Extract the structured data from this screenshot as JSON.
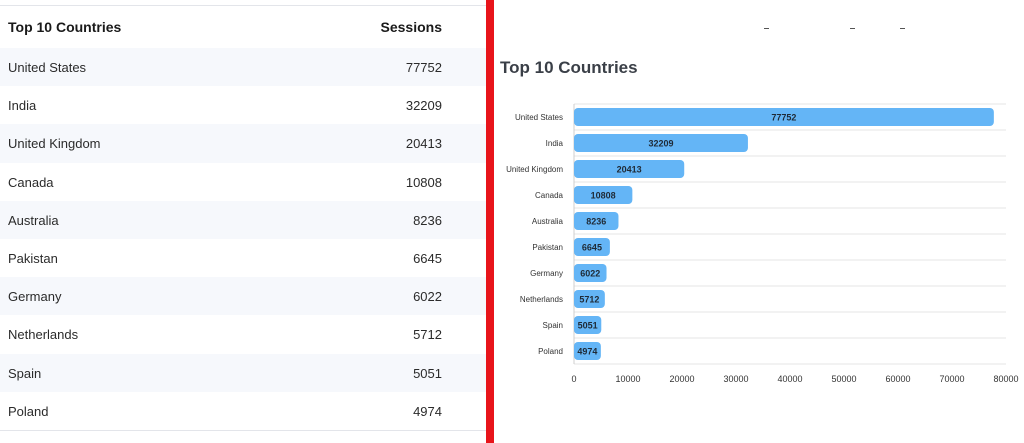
{
  "table": {
    "header": {
      "country": "Top 10 Countries",
      "sessions": "Sessions"
    },
    "rows": [
      {
        "country": "United States",
        "sessions": "77752"
      },
      {
        "country": "India",
        "sessions": "32209"
      },
      {
        "country": "United Kingdom",
        "sessions": "20413"
      },
      {
        "country": "Canada",
        "sessions": "10808"
      },
      {
        "country": "Australia",
        "sessions": "8236"
      },
      {
        "country": "Pakistan",
        "sessions": "6645"
      },
      {
        "country": "Germany",
        "sessions": "6022"
      },
      {
        "country": "Netherlands",
        "sessions": "5712"
      },
      {
        "country": "Spain",
        "sessions": "5051"
      },
      {
        "country": "Poland",
        "sessions": "4974"
      }
    ]
  },
  "colors": {
    "divider": "#e8141a",
    "bar": "#64b5f6",
    "row_stripe": "#f6f8fc"
  },
  "chart_data": {
    "type": "bar",
    "orientation": "horizontal",
    "title": "Top 10 Countries",
    "categories": [
      "United States",
      "India",
      "United Kingdom",
      "Canada",
      "Australia",
      "Pakistan",
      "Germany",
      "Netherlands",
      "Spain",
      "Poland"
    ],
    "values": [
      77752,
      32209,
      20413,
      10808,
      8236,
      6645,
      6022,
      5712,
      5051,
      4974
    ],
    "xlim": [
      0,
      80000
    ],
    "xticks": [
      0,
      10000,
      20000,
      30000,
      40000,
      50000,
      60000,
      70000,
      80000
    ],
    "grid": "horizontal lines between categories",
    "data_labels": true,
    "legend": "none"
  }
}
